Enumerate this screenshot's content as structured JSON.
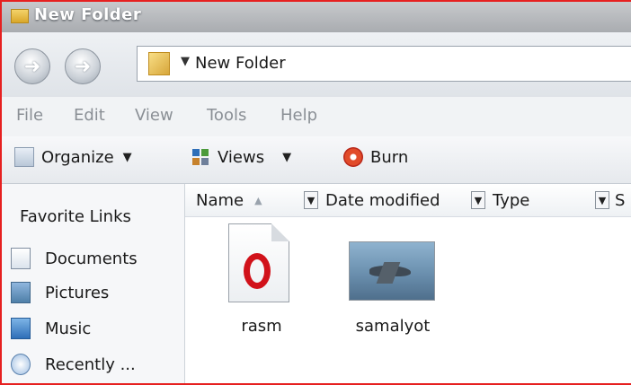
{
  "window": {
    "title": "New Folder"
  },
  "address": {
    "path": "New Folder"
  },
  "menu": {
    "items": [
      "File",
      "Edit",
      "View",
      "Tools",
      "Help"
    ]
  },
  "toolbar": {
    "organize": "Organize",
    "views": "Views",
    "burn": "Burn"
  },
  "sidebar": {
    "title": "Favorite Links",
    "items": [
      {
        "label": "Documents",
        "icon": "documents-icon"
      },
      {
        "label": "Pictures",
        "icon": "pictures-icon"
      },
      {
        "label": "Music",
        "icon": "music-icon"
      },
      {
        "label": "Recently ...",
        "icon": "recent-icon"
      }
    ]
  },
  "columns": {
    "name": "Name",
    "date": "Date modified",
    "type": "Type",
    "size": "S"
  },
  "files": [
    {
      "name": "rasm",
      "icon": "opera-file-icon"
    },
    {
      "name": "samalyot",
      "icon": "image-thumbnail-icon"
    }
  ],
  "colors": {
    "frame_border": "#e62020",
    "menu_text": "#8a8f95",
    "accent": "#3a73c4"
  }
}
